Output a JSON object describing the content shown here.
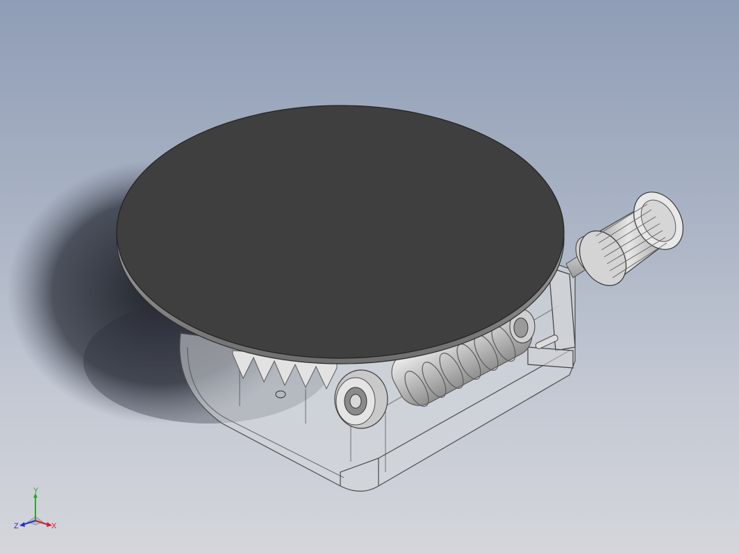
{
  "viewport": {
    "background_top": "#8f9db6",
    "background_bottom": "#d4d6db"
  },
  "model": {
    "turntable_color": "#3f3f3f",
    "housing_color": "#cfd1d6",
    "knob_color": "#d8d8d8"
  },
  "triad": {
    "x_label": "X",
    "y_label": "Y",
    "z_label": "Z",
    "x_color": "#d0202a",
    "y_color": "#2aa62a",
    "z_color": "#2030c8"
  }
}
